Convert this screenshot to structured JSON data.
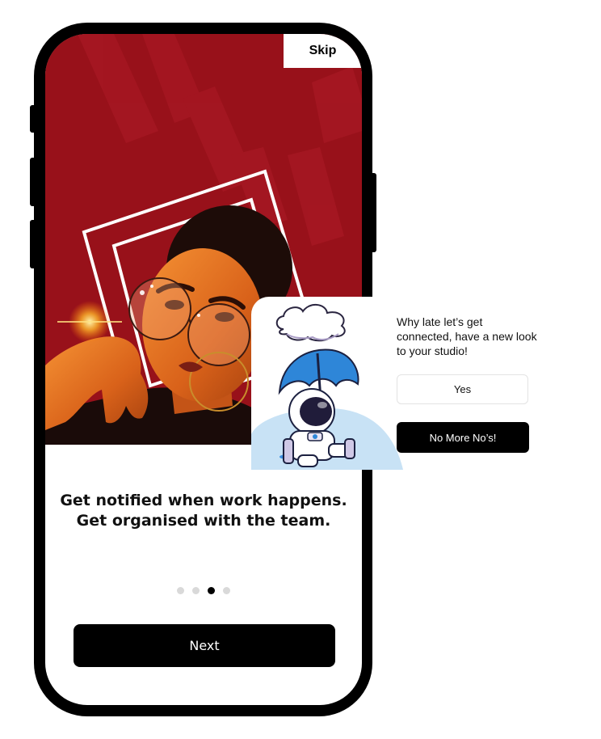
{
  "onboarding": {
    "skip_label": "Skip",
    "headline_line1": "Get notified when work happens.",
    "headline_line2": "Get organised with the team.",
    "pager": {
      "total": 4,
      "active": 3
    },
    "next_label": "Next",
    "hero_background_color": "#98111a"
  },
  "popup": {
    "message": "Why late let’s get connected, have a new look to your studio!",
    "yes_label": "Yes",
    "no_label": "No More No’s!"
  }
}
